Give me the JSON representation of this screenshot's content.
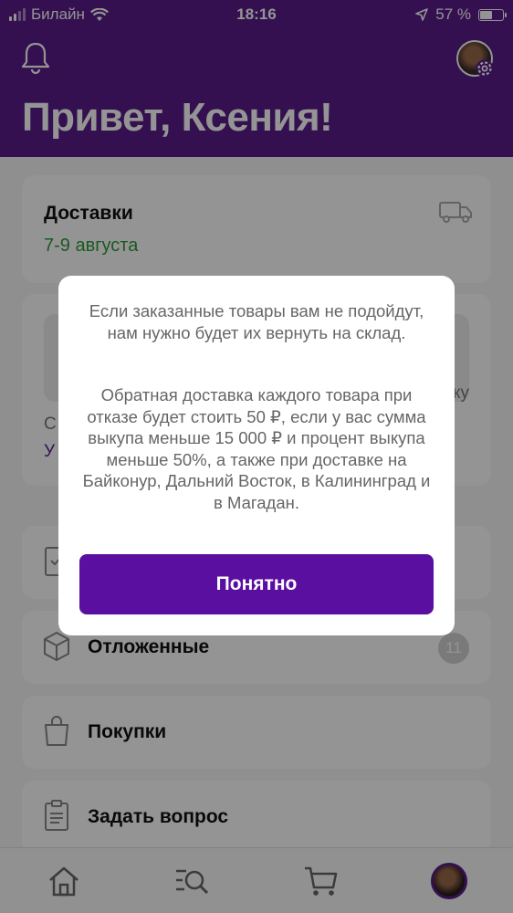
{
  "status_bar": {
    "carrier": "Билайн",
    "time": "18:16",
    "battery": "57 %",
    "battery_level": 0.57
  },
  "header": {
    "greeting": "Привет, Ксения!"
  },
  "deliveries": {
    "title": "Доставки",
    "date": "7-9 августа"
  },
  "middle_card": {
    "right_fragment": "выку",
    "left_fragment_1": "С",
    "left_fragment_2": "У"
  },
  "menu": {
    "orders_label": "",
    "later_label": "Отложенные",
    "later_count": "11",
    "bought_label": "Покупки",
    "ask_label": "Задать вопрос"
  },
  "dialog": {
    "paragraph_1": "Если заказанные товары вам не подойдут, нам нужно будет их вернуть на склад.",
    "paragraph_2": "Обратная доставка каждого товара при отказе будет стоить 50 ₽, если у вас сумма выкупа меньше 15 000 ₽ и процент выкупа меньше 50%, а также при доставке на Байконур, Дальний Восток, в Калининград и в Магадан.",
    "confirm_label": "Понятно"
  },
  "icons": {
    "bell": "bell-icon",
    "truck": "truck-icon",
    "home": "home-icon",
    "search": "search-icon",
    "cart": "cart-icon"
  },
  "colors": {
    "brand": "#5a1d8a",
    "button": "#5b0fa0",
    "delivery_date": "#2d9a3a"
  }
}
